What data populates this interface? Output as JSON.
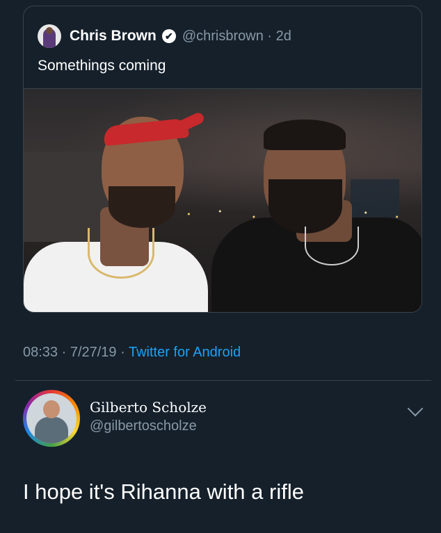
{
  "quoted_tweet": {
    "author_name": "Chris Brown",
    "verified_glyph": "✔",
    "handle_time": "@chrisbrown · 2d",
    "text": "Somethings coming",
    "media_description_icon": "photo",
    "timestamp": "08:33 · 7/27/19 · ",
    "source": "Twitter for Android"
  },
  "reply": {
    "author_name": "Gilberto Scholze",
    "handle": "@gilbertoscholze",
    "text": "I hope it's Rihanna with a rifle"
  },
  "colors": {
    "background": "#15202b",
    "border": "#38444d",
    "muted_text": "#8899a6",
    "link": "#1da1f2",
    "text": "#ffffff"
  }
}
